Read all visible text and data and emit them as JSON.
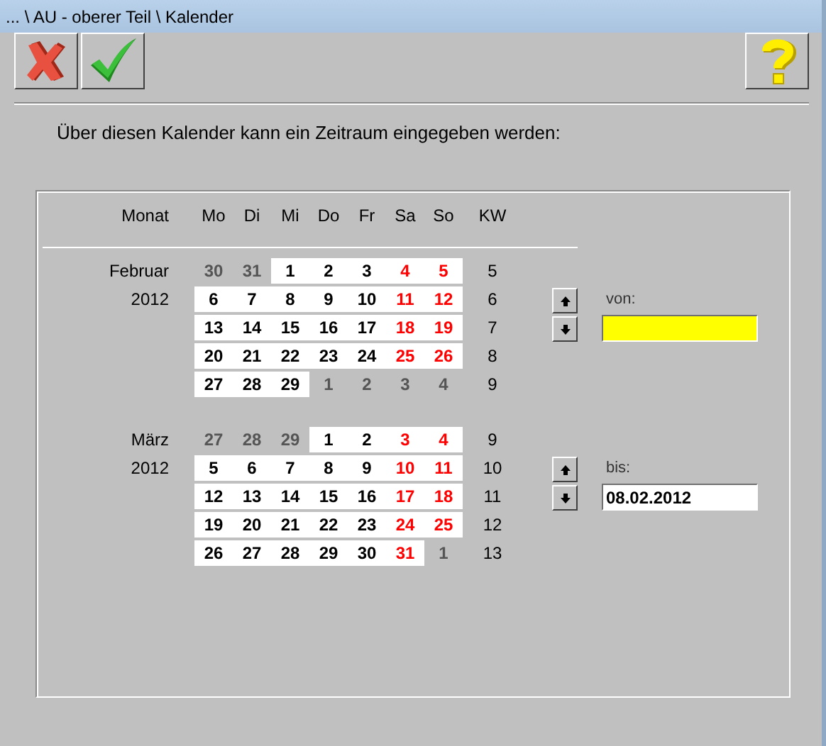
{
  "window": {
    "title": "... \\ AU - oberer Teil \\ Kalender"
  },
  "toolbar": [
    {
      "kind": "cancel"
    },
    {
      "kind": "confirm"
    },
    {
      "kind": "help"
    }
  ],
  "intro": "Über diesen Kalender kann ein Zeitraum eingegeben werden:",
  "calendar": {
    "header": {
      "month": "Monat",
      "days": [
        "Mo",
        "Di",
        "Mi",
        "Do",
        "Fr",
        "Sa",
        "So"
      ],
      "week": "KW"
    },
    "months": [
      {
        "name": "Februar",
        "year": "2012",
        "field": {
          "label": "von:",
          "highlighted": true
        },
        "weeks": [
          {
            "week": "5",
            "days": [
              {
                "day": "30",
                "kind": "out"
              },
              {
                "day": "31",
                "kind": "out"
              },
              {
                "day": "1",
                "kind": "work"
              },
              {
                "day": "2",
                "kind": "work"
              },
              {
                "day": "3",
                "kind": "work"
              },
              {
                "day": "4",
                "kind": "weekend"
              },
              {
                "day": "5",
                "kind": "weekend"
              }
            ]
          },
          {
            "week": "6",
            "days": [
              {
                "day": "6",
                "kind": "work"
              },
              {
                "day": "7",
                "kind": "work"
              },
              {
                "day": "8",
                "kind": "work"
              },
              {
                "day": "9",
                "kind": "work"
              },
              {
                "day": "10",
                "kind": "work"
              },
              {
                "day": "11",
                "kind": "weekend"
              },
              {
                "day": "12",
                "kind": "weekend"
              }
            ]
          },
          {
            "week": "7",
            "days": [
              {
                "day": "13",
                "kind": "work"
              },
              {
                "day": "14",
                "kind": "work"
              },
              {
                "day": "15",
                "kind": "work"
              },
              {
                "day": "16",
                "kind": "work"
              },
              {
                "day": "17",
                "kind": "work"
              },
              {
                "day": "18",
                "kind": "weekend"
              },
              {
                "day": "19",
                "kind": "weekend"
              }
            ]
          },
          {
            "week": "8",
            "days": [
              {
                "day": "20",
                "kind": "work"
              },
              {
                "day": "21",
                "kind": "work"
              },
              {
                "day": "22",
                "kind": "work"
              },
              {
                "day": "23",
                "kind": "work"
              },
              {
                "day": "24",
                "kind": "work"
              },
              {
                "day": "25",
                "kind": "weekend"
              },
              {
                "day": "26",
                "kind": "weekend"
              }
            ]
          },
          {
            "week": "9",
            "days": [
              {
                "day": "27",
                "kind": "work"
              },
              {
                "day": "28",
                "kind": "work"
              },
              {
                "day": "29",
                "kind": "work"
              },
              {
                "day": "1",
                "kind": "out"
              },
              {
                "day": "2",
                "kind": "out"
              },
              {
                "day": "3",
                "kind": "out"
              },
              {
                "day": "4",
                "kind": "out"
              }
            ]
          }
        ]
      },
      {
        "name": "März",
        "year": "2012",
        "field": {
          "label": "bis:",
          "value": "08.02.2012",
          "highlighted": false
        },
        "weeks": [
          {
            "week": "9",
            "days": [
              {
                "day": "27",
                "kind": "out"
              },
              {
                "day": "28",
                "kind": "out"
              },
              {
                "day": "29",
                "kind": "out"
              },
              {
                "day": "1",
                "kind": "work"
              },
              {
                "day": "2",
                "kind": "work"
              },
              {
                "day": "3",
                "kind": "weekend"
              },
              {
                "day": "4",
                "kind": "weekend"
              }
            ]
          },
          {
            "week": "10",
            "days": [
              {
                "day": "5",
                "kind": "work"
              },
              {
                "day": "6",
                "kind": "work"
              },
              {
                "day": "7",
                "kind": "work"
              },
              {
                "day": "8",
                "kind": "work"
              },
              {
                "day": "9",
                "kind": "work"
              },
              {
                "day": "10",
                "kind": "weekend"
              },
              {
                "day": "11",
                "kind": "weekend"
              }
            ]
          },
          {
            "week": "11",
            "days": [
              {
                "day": "12",
                "kind": "work"
              },
              {
                "day": "13",
                "kind": "work"
              },
              {
                "day": "14",
                "kind": "work"
              },
              {
                "day": "15",
                "kind": "work"
              },
              {
                "day": "16",
                "kind": "work"
              },
              {
                "day": "17",
                "kind": "weekend"
              },
              {
                "day": "18",
                "kind": "weekend"
              }
            ]
          },
          {
            "week": "12",
            "days": [
              {
                "day": "19",
                "kind": "work"
              },
              {
                "day": "20",
                "kind": "work"
              },
              {
                "day": "21",
                "kind": "work"
              },
              {
                "day": "22",
                "kind": "work"
              },
              {
                "day": "23",
                "kind": "work"
              },
              {
                "day": "24",
                "kind": "weekend"
              },
              {
                "day": "25",
                "kind": "weekend"
              }
            ]
          },
          {
            "week": "13",
            "days": [
              {
                "day": "26",
                "kind": "work"
              },
              {
                "day": "27",
                "kind": "work"
              },
              {
                "day": "28",
                "kind": "work"
              },
              {
                "day": "29",
                "kind": "work"
              },
              {
                "day": "30",
                "kind": "work"
              },
              {
                "day": "31",
                "kind": "weekend"
              },
              {
                "day": "1",
                "kind": "out"
              }
            ]
          }
        ]
      }
    ]
  }
}
